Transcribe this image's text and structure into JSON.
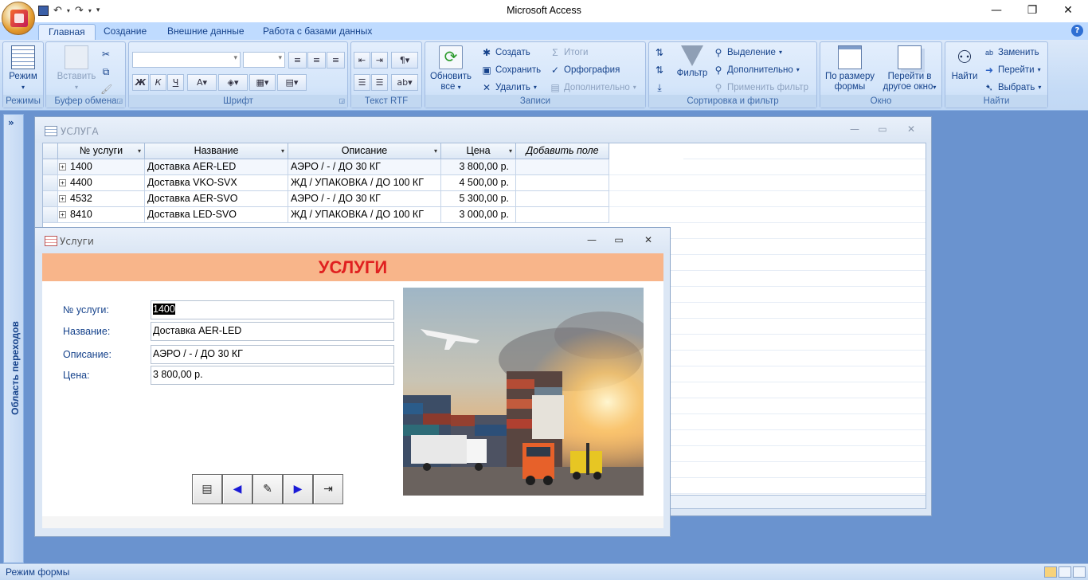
{
  "app": {
    "title": "Microsoft Access"
  },
  "ribbon": {
    "tabs": [
      "Главная",
      "Создание",
      "Внешние данные",
      "Работа с базами данных"
    ],
    "active_tab": "Главная",
    "groups": {
      "views": {
        "label": "Режимы",
        "mode_button": "Режим"
      },
      "clipboard": {
        "label": "Буфер обмена",
        "paste": "Вставить"
      },
      "font": {
        "label": "Шрифт",
        "bold": "Ж",
        "italic": "К",
        "underline": "Ч"
      },
      "rtf": {
        "label": "Текст RTF"
      },
      "records": {
        "label": "Записи",
        "refresh_line1": "Обновить",
        "refresh_line2": "все",
        "create": "Создать",
        "save": "Сохранить",
        "delete": "Удалить",
        "totals": "Итоги",
        "spelling": "Орфография",
        "more": "Дополнительно"
      },
      "sort": {
        "label": "Сортировка и фильтр",
        "filter": "Фильтр",
        "selection": "Выделение",
        "advanced": "Дополнительно",
        "toggle": "Применить фильтр"
      },
      "window": {
        "label": "Окно",
        "fit_line1": "По размеру",
        "fit_line2": "формы",
        "switch_line1": "Перейти в",
        "switch_line2": "другое окно"
      },
      "find": {
        "label": "Найти",
        "find": "Найти",
        "replace": "Заменить",
        "goto": "Перейти",
        "select": "Выбрать"
      }
    }
  },
  "navpane": {
    "label": "Область переходов"
  },
  "table_window": {
    "title": "УСЛУГА",
    "columns": [
      "№ услуги",
      "Название",
      "Описание",
      "Цена",
      "Добавить поле"
    ],
    "rows": [
      {
        "id": "1400",
        "name": "Доставка AER-LED",
        "desc": "АЭРО / - / ДО 30 КГ",
        "price": "3 800,00 р."
      },
      {
        "id": "4400",
        "name": "Доставка VKO-SVX",
        "desc": "ЖД / УПАКОВКА / ДО 100 КГ",
        "price": "4 500,00 р."
      },
      {
        "id": "4532",
        "name": "Доставка AER-SVO",
        "desc": "АЭРО / - / ДО 30 КГ",
        "price": "5 300,00 р."
      },
      {
        "id": "8410",
        "name": "Доставка LED-SVO",
        "desc": "ЖД / УПАКОВКА / ДО 100 КГ",
        "price": "3 000,00 р."
      }
    ]
  },
  "form_window": {
    "title": "Услуги",
    "header": "УСЛУГИ",
    "fields": [
      {
        "label": "№ услуги:",
        "value": "1400"
      },
      {
        "label": "Название:",
        "value": "Доставка AER-LED"
      },
      {
        "label": "Описание:",
        "value": "АЭРО / - / ДО 30 КГ"
      },
      {
        "label": "Цена:",
        "value": "3 800,00 р."
      }
    ],
    "nav_buttons": [
      "save-record-icon",
      "previous-record-icon",
      "edit-record-icon",
      "next-record-icon",
      "close-form-icon"
    ]
  },
  "status": {
    "text": "Режим формы"
  },
  "colors": {
    "form_header_bg": "#f8b58a",
    "form_header_text": "#e02020"
  }
}
